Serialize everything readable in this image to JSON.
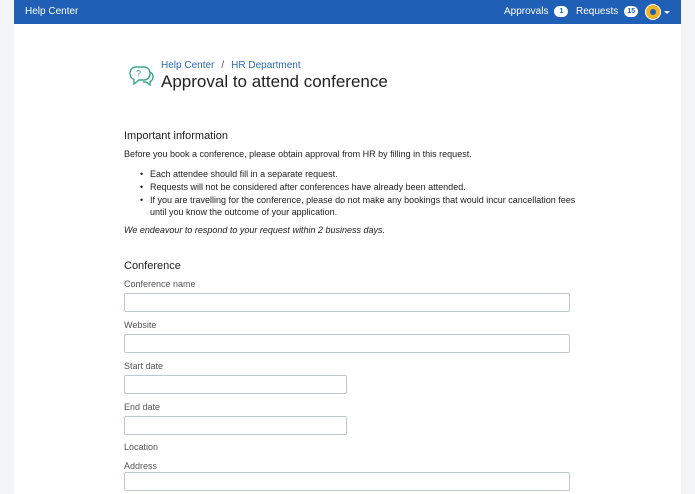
{
  "topbar": {
    "brand": "Help Center",
    "approvals": {
      "label": "Approvals",
      "count": "1"
    },
    "requests": {
      "label": "Requests",
      "count": "15"
    }
  },
  "breadcrumb": {
    "home": "Help Center",
    "separator": "/",
    "department": "HR Department"
  },
  "page_title": "Approval to attend conference",
  "info": {
    "heading": "Important information",
    "intro": "Before you book a conference, please obtain approval from HR by filling in this request.",
    "bullets": [
      "Each attendee should fill in a separate request.",
      "Requests will not be considered after conferences have already been attended.",
      "If you are travelling for the conference, please do not make any bookings that would incur cancellation fees until you know the outcome of your application."
    ],
    "note": "We endeavour to respond to your request within 2 business days."
  },
  "conference": {
    "heading": "Conference",
    "fields": {
      "name": {
        "label": "Conference name",
        "value": ""
      },
      "website": {
        "label": "Website",
        "value": ""
      },
      "start_date": {
        "label": "Start date",
        "value": ""
      },
      "end_date": {
        "label": "End date",
        "value": ""
      },
      "location": {
        "label": "Location"
      },
      "address": {
        "label": "Address",
        "value": ""
      }
    }
  },
  "colors": {
    "header": "#1f5fb5",
    "link": "#2a6bb5",
    "icon": "#3aa88a",
    "avatar": "#f0b323"
  }
}
